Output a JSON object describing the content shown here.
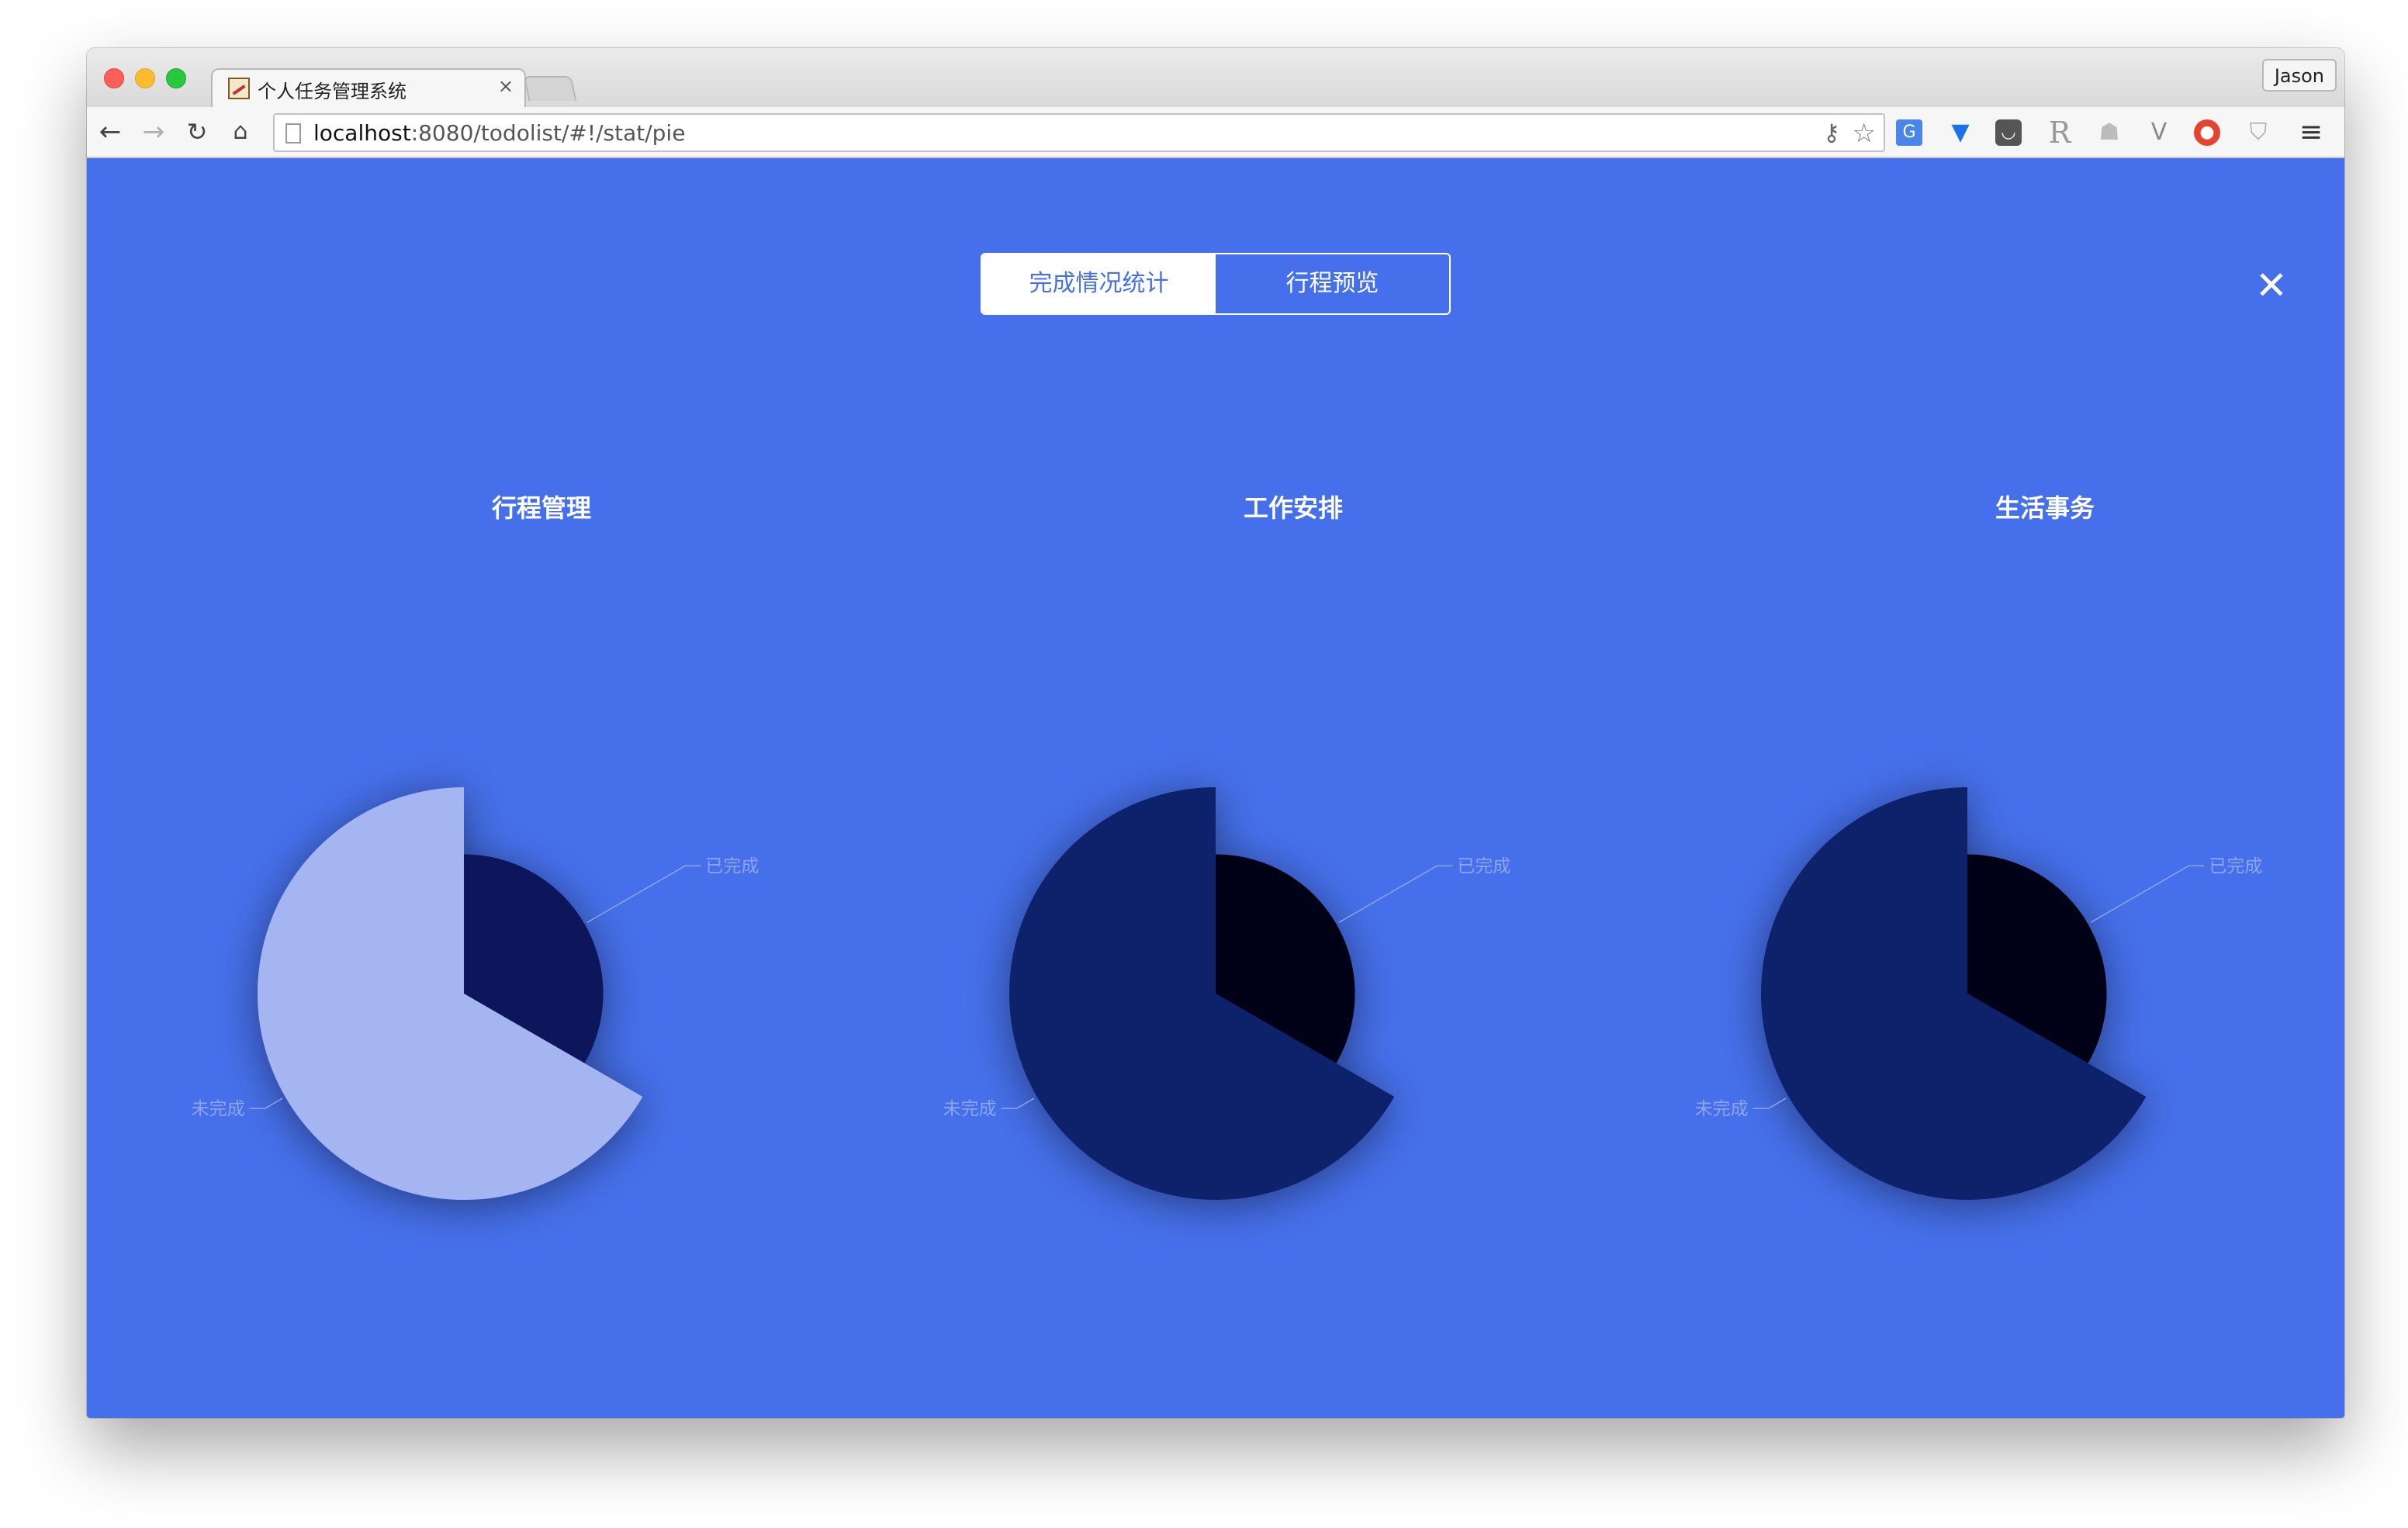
{
  "browser": {
    "tab_title": "个人任务管理系统",
    "tab_close": "×",
    "profile_name": "Jason",
    "url_host": "localhost",
    "url_rest": ":8080/todolist/#!/stat/pie",
    "icons": {
      "back": "←",
      "forward": "→",
      "reload": "↻",
      "home": "⌂",
      "key": "⚷",
      "star": "☆",
      "menu": "≡"
    },
    "extensions": {
      "translate": "G",
      "diamond": "▼",
      "pocket": "◡",
      "r": "R",
      "people": "☗",
      "v": "V",
      "red": "●",
      "shield": "⛉"
    }
  },
  "page": {
    "close_glyph": "✕",
    "tabs": [
      {
        "label": "完成情况统计",
        "active": true
      },
      {
        "label": "行程预览",
        "active": false
      }
    ],
    "colors": {
      "background": "#4670eb",
      "label_color": "#8ea4f0"
    }
  },
  "chart_data": [
    {
      "type": "pie",
      "title": "行程管理",
      "slices": [
        {
          "name": "已完成",
          "value": 1,
          "color": "#08175a"
        },
        {
          "name": "未完成",
          "value": 2,
          "color": "#a4b5f2"
        }
      ]
    },
    {
      "type": "pie",
      "title": "工作安排",
      "slices": [
        {
          "name": "已完成",
          "value": 1,
          "color": "#020612"
        },
        {
          "name": "未完成",
          "value": 2,
          "color": "#0a226a"
        }
      ]
    },
    {
      "type": "pie",
      "title": "生活事务",
      "slices": [
        {
          "name": "已完成",
          "value": 1,
          "color": "#020612"
        },
        {
          "name": "未完成",
          "value": 2,
          "color": "#0a226a"
        }
      ]
    }
  ]
}
